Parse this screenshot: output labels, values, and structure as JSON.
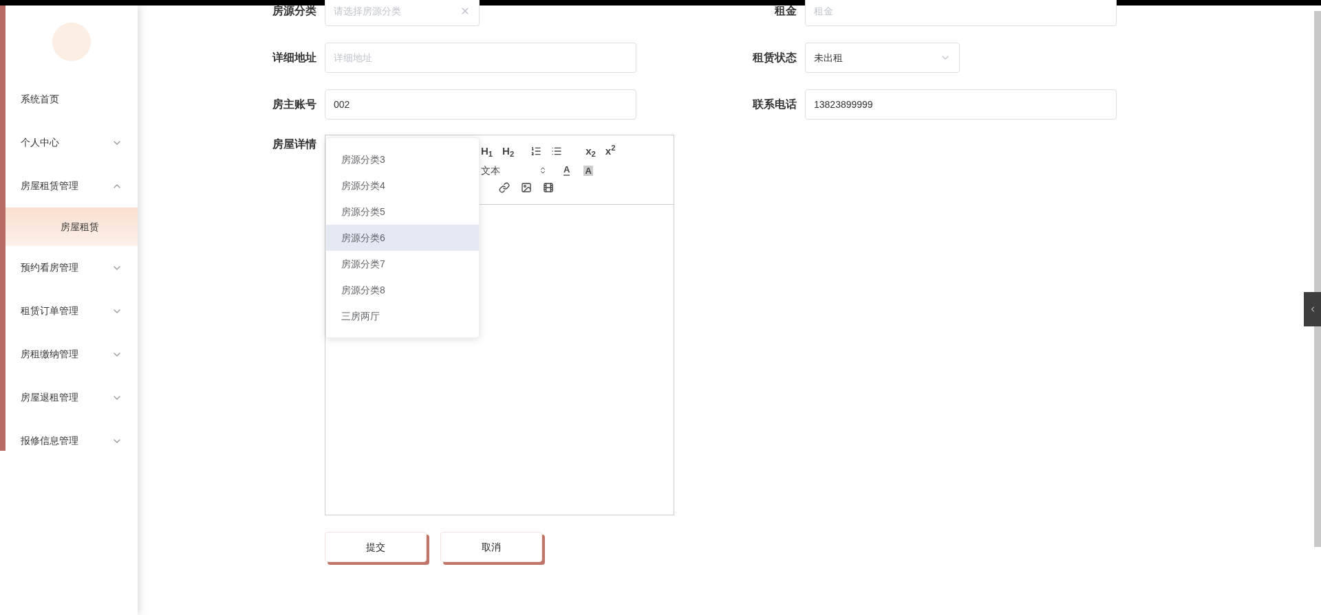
{
  "sidebar": {
    "items": [
      {
        "label": "系统首页"
      },
      {
        "label": "个人中心",
        "expanded": false
      },
      {
        "label": "房屋租赁管理",
        "expanded": true,
        "children": [
          {
            "label": "房屋租赁",
            "selected": true
          }
        ]
      },
      {
        "label": "预约看房管理",
        "expanded": false
      },
      {
        "label": "租赁订单管理",
        "expanded": false
      },
      {
        "label": "房租缴纳管理",
        "expanded": false
      },
      {
        "label": "房屋退租管理",
        "expanded": false
      },
      {
        "label": "报修信息管理",
        "expanded": false
      }
    ]
  },
  "form": {
    "rows": [
      [
        {
          "label": "房源分类",
          "kind": "select",
          "placeholder": "请选择房源分类",
          "clearable": true
        },
        {
          "label": "租金",
          "kind": "input",
          "placeholder": "租金"
        }
      ],
      [
        {
          "label": "详细地址",
          "kind": "input",
          "placeholder": "详细地址"
        },
        {
          "label": "租赁状态",
          "kind": "select",
          "value": "未出租"
        }
      ],
      [
        {
          "label": "房主账号",
          "kind": "input",
          "value": "002"
        },
        {
          "label": "联系电话",
          "kind": "input",
          "value": "13823899999"
        }
      ]
    ],
    "editor": {
      "label": "房屋详情",
      "font_select": "文本",
      "toolbar_row1": [
        "H$_{1}$",
        "H$_{2}$",
        "x$_{2}$",
        "x$^{2}$"
      ],
      "font_color": "A",
      "background_color": "A"
    },
    "dropdown": {
      "options": [
        {
          "label": "房源分类3",
          "highlighted": false
        },
        {
          "label": "房源分类4",
          "highlighted": false
        },
        {
          "label": "房源分类5",
          "highlighted": false
        },
        {
          "label": "房源分类6",
          "highlighted": true
        },
        {
          "label": "房源分类7",
          "highlighted": false
        },
        {
          "label": "房源分类8",
          "highlighted": false
        },
        {
          "label": "三房两厅",
          "highlighted": false
        }
      ]
    },
    "buttons": [
      "提交",
      "取消"
    ]
  }
}
